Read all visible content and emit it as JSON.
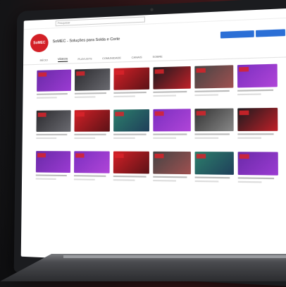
{
  "youtube": {
    "search_placeholder": "Pesquisar",
    "channel_avatar_text": "SoMEC",
    "channel_name": "SoMEC - Soluções para Solda e Corte",
    "channel_subscribers": "",
    "subscribe_label": "",
    "join_label": "",
    "tabs": [
      "INÍCIO",
      "VÍDEOS",
      "PLAYLISTS",
      "COMUNIDADE",
      "CANAIS",
      "SOBRE"
    ],
    "active_tab": "VÍDEOS"
  }
}
